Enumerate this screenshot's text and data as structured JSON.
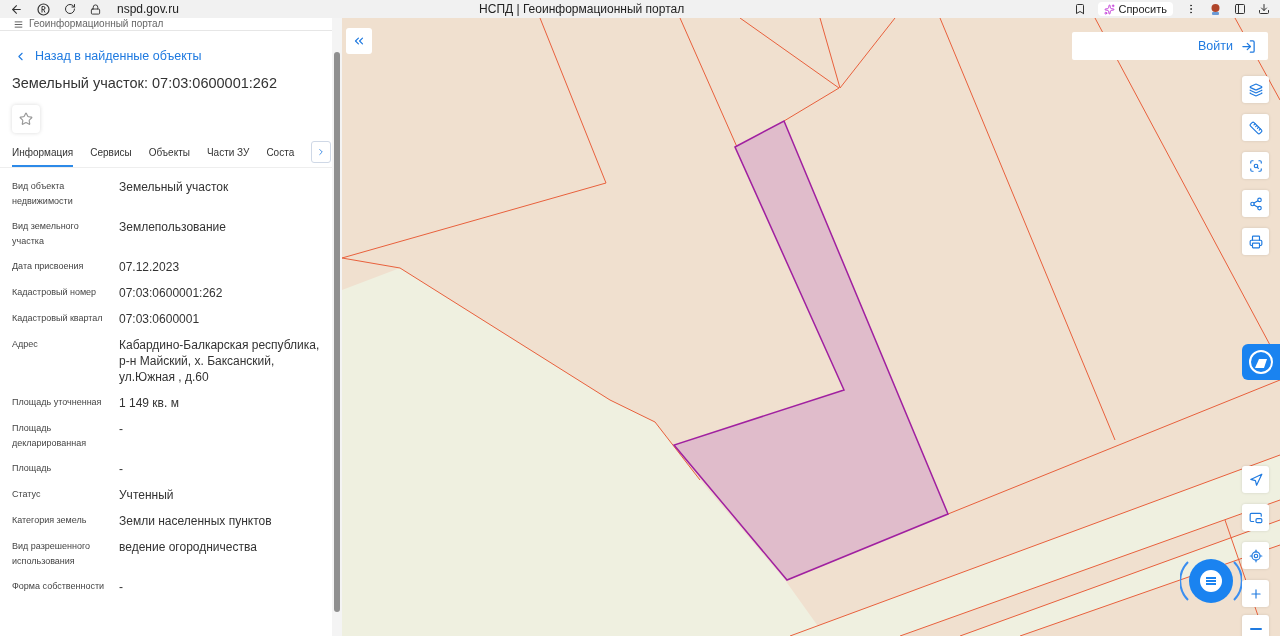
{
  "browser": {
    "url": "nspd.gov.ru",
    "title": "НСПД | Геоинформационный портал",
    "ask_button": "Спросить"
  },
  "portal_header": {
    "title": "Геоинформационный портал"
  },
  "panel": {
    "back_link": "Назад в найденные объекты",
    "heading": "Земельный участок: 07:03:0600001:262",
    "tabs": [
      {
        "label": "Информация",
        "selected": true
      },
      {
        "label": "Сервисы",
        "selected": false
      },
      {
        "label": "Объекты",
        "selected": false
      },
      {
        "label": "Части ЗУ",
        "selected": false
      },
      {
        "label": "Соста",
        "selected": false
      }
    ],
    "properties": [
      {
        "label": "Вид объекта недвижимости",
        "value": "Земельный участок"
      },
      {
        "label": "Вид земельного участка",
        "value": "Землепользование"
      },
      {
        "label": "Дата присвоения",
        "value": "07.12.2023"
      },
      {
        "label": "Кадастровый номер",
        "value": "07:03:0600001:262"
      },
      {
        "label": "Кадастровый квартал",
        "value": "07:03:0600001"
      },
      {
        "label": "Адрес",
        "value": "Кабардино-Балкарская республика, р-н Майский, х. Баксанский, ул.Южная , д.60"
      },
      {
        "label": "Площадь уточненная",
        "value": "1 149 кв. м"
      },
      {
        "label": "Площадь декларированная",
        "value": "-"
      },
      {
        "label": "Площадь",
        "value": "-"
      },
      {
        "label": "Статус",
        "value": "Учтенный"
      },
      {
        "label": "Категория земель",
        "value": "Земли населенных пунктов"
      },
      {
        "label": "Вид разрешенного использования",
        "value": "ведение огородничества"
      },
      {
        "label": "Форма собственности",
        "value": "-"
      }
    ]
  },
  "map": {
    "login_button": "Войти"
  }
}
